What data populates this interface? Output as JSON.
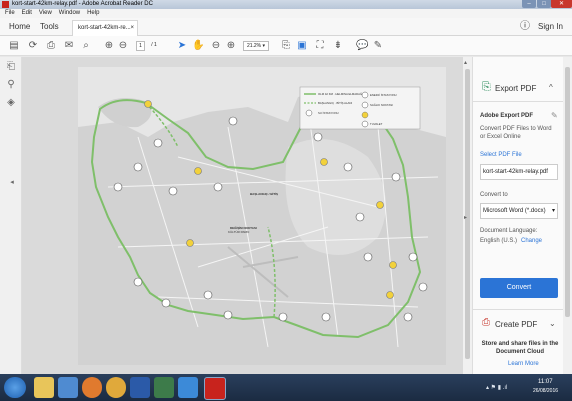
{
  "window": {
    "title": "kort-start-42km-relay.pdf - Adobe Acrobat Reader DC"
  },
  "menu": [
    "File",
    "Edit",
    "View",
    "Window",
    "Help"
  ],
  "tabs": {
    "home": "Home",
    "tools": "Tools",
    "document": "kort-start-42km-re..."
  },
  "toolbar": {
    "page_current": "1",
    "page_total": "/ 1",
    "zoom": "21.2%"
  },
  "account": {
    "sign_in": "Sign In"
  },
  "legend": {
    "rows": [
      "OLM 42 KM · HELMINA ELMADAĞ",
      "BAŞLANGIÇ · BİTİŞ ALANI",
      "SU İSTASYONU",
      "ENERJİ İSTASYONU",
      "SAĞLIK NOKTASI",
      "TUVALET"
    ]
  },
  "map_labels": [
    "BAŞLANGIÇ / BİTİŞ",
    "DEĞİŞİM NOKTASI",
    "KÜLTÜR PARKI"
  ],
  "panel": {
    "export_title": "Export PDF",
    "section_title": "Adobe Export PDF",
    "desc": "Convert PDF Files to Word or Excel Online",
    "select_label": "Select PDF File",
    "file_name": "kort-start-42km-relay.pdf",
    "convert_to_label": "Convert to",
    "convert_to_value": "Microsoft Word (*.docx)",
    "doc_lang_label": "Document Language:",
    "doc_lang_value": "English (U.S.)",
    "change_link": "Change",
    "convert_button": "Convert",
    "create_pdf": "Create PDF",
    "store_text": "Store and share files in the Document Cloud",
    "learn_more": "Learn More"
  },
  "tray": {
    "time": "11:07",
    "date": "26/08/2016"
  },
  "colors": {
    "route": "#7fbf6a",
    "accent": "#2b74d6",
    "convert_btn": "#2b74d6",
    "taskbar": "#1f3350"
  }
}
